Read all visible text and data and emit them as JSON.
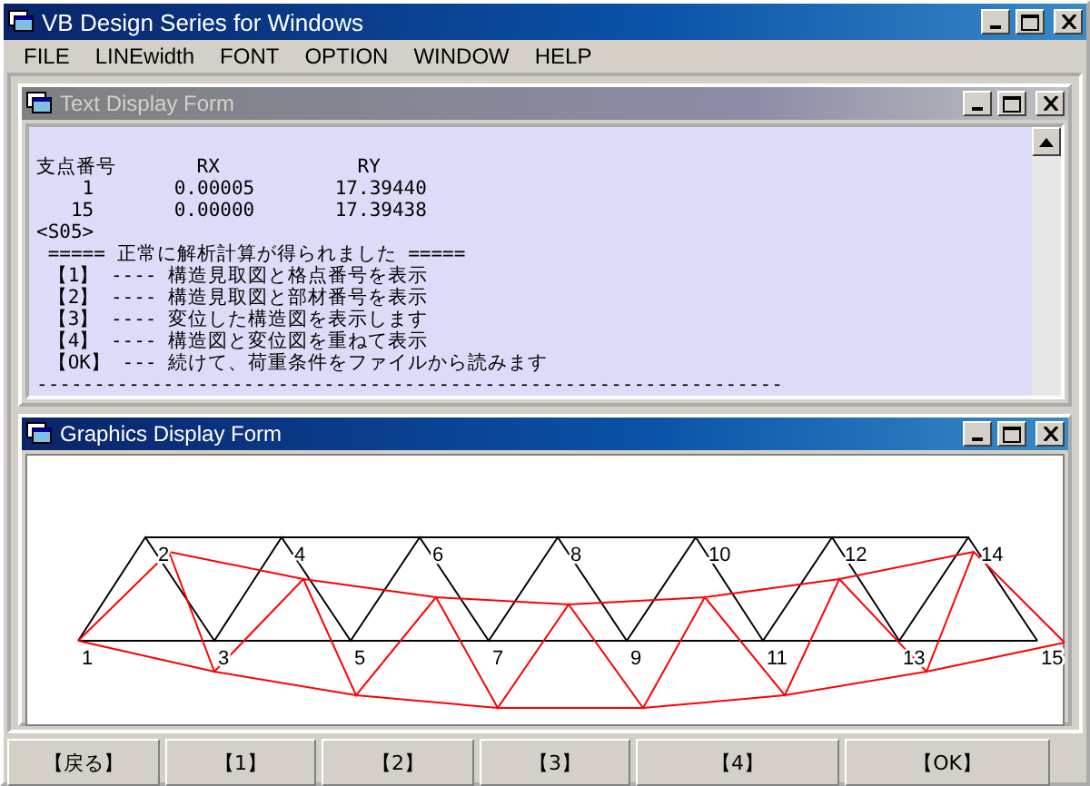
{
  "window": {
    "title": "VB Design Series for Windows"
  },
  "menu": [
    "FILE",
    "LINEwidth",
    "FONT",
    "OPTION",
    "WINDOW",
    "HELP"
  ],
  "text_form": {
    "title": "Text Display Form",
    "active": false,
    "lines": [
      "支点番号       RX            RY",
      "    1       0.00005       17.39440",
      "   15       0.00000       17.39438",
      "<S05>",
      " ===== 正常に解析計算が得られました =====",
      " 【1】 ---- 構造見取図と格点番号を表示",
      " 【2】 ---- 構造見取図と部材番号を表示",
      " 【3】 ---- 変位した構造図を表示します",
      " 【4】 ---- 構造図と変位図を重ねて表示",
      " 【OK】 --- 続けて、荷重条件をファイルから読みます",
      "-----------------------------------------------------------------"
    ]
  },
  "graphics_form": {
    "title": "Graphics Display Form",
    "active": true,
    "node_labels": [
      "1",
      "2",
      "3",
      "4",
      "5",
      "6",
      "7",
      "8",
      "9",
      "10",
      "11",
      "12",
      "13",
      "14",
      "15"
    ]
  },
  "buttons": [
    "【戻る】",
    "【1】",
    "【2】",
    "【3】",
    "【4】",
    "【OK】"
  ]
}
